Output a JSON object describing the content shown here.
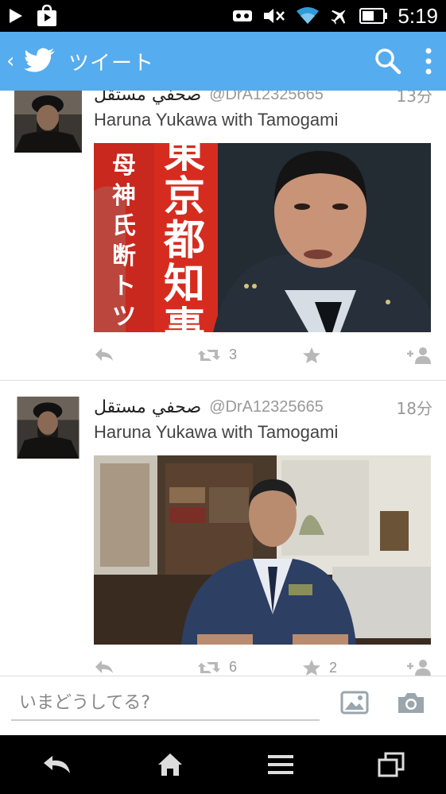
{
  "status_bar": {
    "time": "5:19",
    "icons": [
      "play-icon",
      "play-store-icon",
      "voicemail-icon",
      "mute-icon",
      "wifi-icon",
      "airplane-icon",
      "battery-icon"
    ]
  },
  "app_bar": {
    "title": "ツイート",
    "back_icon": "back-chevron-icon",
    "logo": "twitter-bird-icon",
    "search_icon": "search-icon",
    "menu_icon": "overflow-menu-icon",
    "color": "#55acee"
  },
  "tweets": [
    {
      "name": "صحفي مستقل",
      "handle": "@DrA12325665",
      "time": "13分",
      "text": "Haruna Yukawa with Tamogami",
      "image_text": [
        "東京都知事",
        "母神氏断トツ"
      ],
      "actions": {
        "reply": "",
        "retweets": "3",
        "favorites": "",
        "follow": ""
      }
    },
    {
      "name": "صحفي مستقل",
      "handle": "@DrA12325665",
      "time": "18分",
      "text": "Haruna Yukawa with Tamogami",
      "image_text": [],
      "actions": {
        "reply": "",
        "retweets": "6",
        "favorites": "2",
        "follow": ""
      }
    }
  ],
  "compose": {
    "placeholder": "いまどうしてる?",
    "gallery_icon": "image-icon",
    "camera_icon": "camera-icon"
  },
  "nav_bar": {
    "icons": [
      "back-icon",
      "home-icon",
      "menu-icon",
      "recent-apps-icon"
    ]
  }
}
